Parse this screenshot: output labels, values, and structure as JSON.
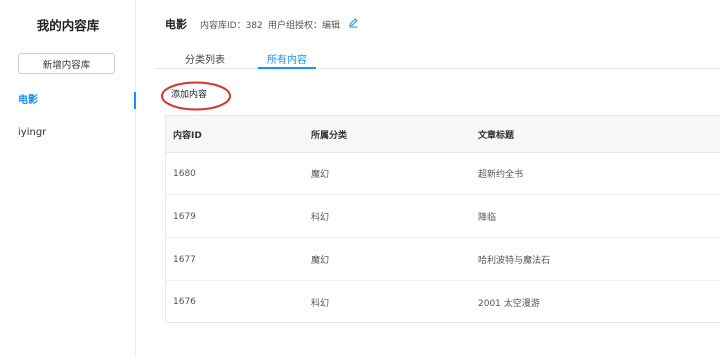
{
  "sidebar": {
    "title": "我的内容库",
    "new_button": "新增内容库",
    "items": [
      {
        "label": "电影",
        "active": true
      },
      {
        "label": "iyingr",
        "active": false
      }
    ]
  },
  "header": {
    "title": "电影",
    "library_id": "内容库ID：382",
    "permission": "用户组授权：编辑",
    "edit_icon": "pencil-icon"
  },
  "tabs": [
    {
      "label": "分类列表",
      "active": false
    },
    {
      "label": "所有内容",
      "active": true
    }
  ],
  "add_button": "添加内容",
  "annotation_color": "#d8352a",
  "accent_color": "#1890ff",
  "table": {
    "columns": [
      "内容ID",
      "所属分类",
      "文章标题"
    ],
    "rows": [
      [
        "1680",
        "魔幻",
        "超新约全书"
      ],
      [
        "1679",
        "科幻",
        "降临"
      ],
      [
        "1677",
        "魔幻",
        "哈利波特与魔法石"
      ],
      [
        "1676",
        "科幻",
        "2001 太空漫游"
      ]
    ]
  }
}
